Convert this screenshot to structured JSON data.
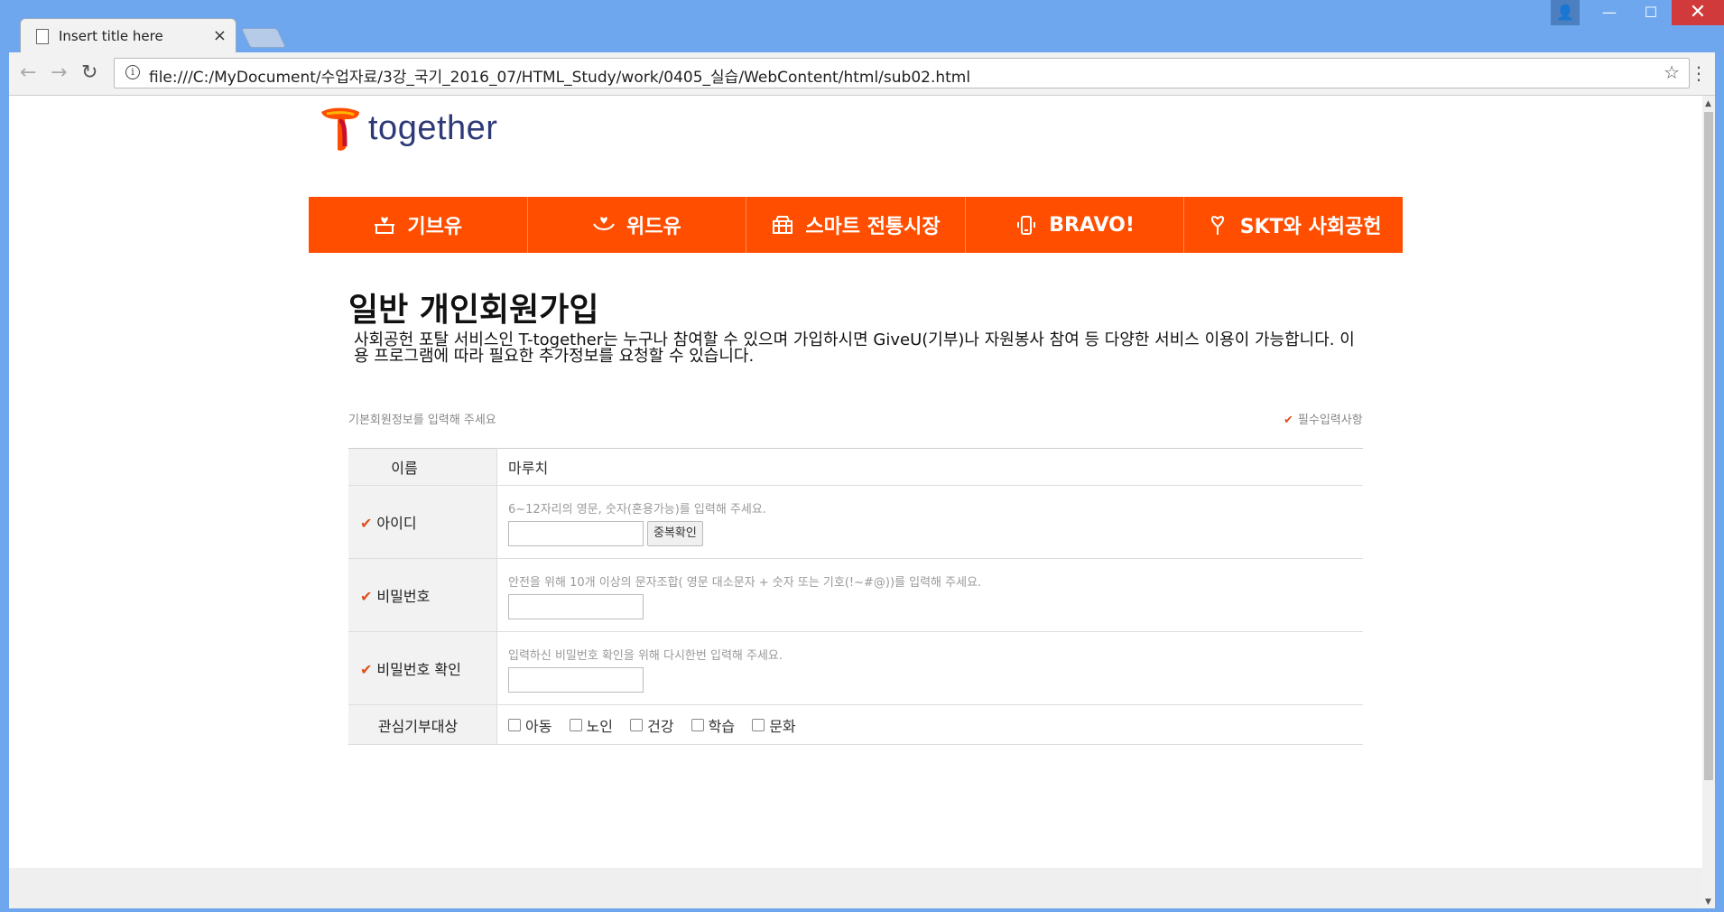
{
  "browser": {
    "tab_title": "Insert title here",
    "tab_close": "×",
    "url": "file:///C:/MyDocument/수업자료/3강_국기_2016_07/HTML_Study/work/0405_실습/WebContent/html/sub02.html",
    "back": "←",
    "forward": "→",
    "reload": "↻",
    "info": "i",
    "star": "☆",
    "menu": "⋮",
    "window_user": "👤",
    "minimize": "—",
    "maximize": "☐",
    "close": "✕"
  },
  "logo": {
    "brand": "together"
  },
  "gnb": {
    "items": [
      {
        "label": "기브유",
        "icon": "gift-heart-icon"
      },
      {
        "label": "위드유",
        "icon": "hands-heart-icon"
      },
      {
        "label": "스마트 전통시장",
        "icon": "basket-icon"
      },
      {
        "label": "BRAVO!",
        "icon": "phone-icon"
      },
      {
        "label": "SKT와 사회공헌",
        "icon": "heart-tree-icon"
      }
    ]
  },
  "page": {
    "title": "일반 개인회원가입",
    "intro": "사회공헌 포탈 서비스인 T-together는 누구나 참여할 수 있으며 가입하시면 GiveU(기부)나 자원봉사 참여 등 다양한 서비스 이용이 가능합니다. 이용 프로그램에 따라 필요한 추가정보를 요청할 수 있습니다.",
    "sub_left": "기본회원정보를 입력해 주세요",
    "sub_right": "필수입력사항",
    "check_mark": "✔"
  },
  "form": {
    "name": {
      "label": "이름",
      "value": "마루치"
    },
    "userid": {
      "label": "아이디",
      "hint": "6~12자리의 영문, 숫자(혼용가능)를 입력해 주세요.",
      "value": "",
      "button": "중복확인"
    },
    "password": {
      "label": "비밀번호",
      "hint": "안전을 위해 10개 이상의 문자조합( 영문 대소문자 + 숫자 또는 기호(!~#@))를 입력해 주세요.",
      "value": ""
    },
    "password_confirm": {
      "label": "비밀번호 확인",
      "hint": "입력하신 비밀번호 확인을 위해 다시한번 입력해 주세요.",
      "value": ""
    },
    "interests": {
      "label": "관심기부대상",
      "options": [
        "아동",
        "노인",
        "건강",
        "학습",
        "문화"
      ]
    }
  },
  "colors": {
    "accent": "#ff4e00",
    "check": "#e0501e",
    "brand_text": "#2e3a78"
  }
}
